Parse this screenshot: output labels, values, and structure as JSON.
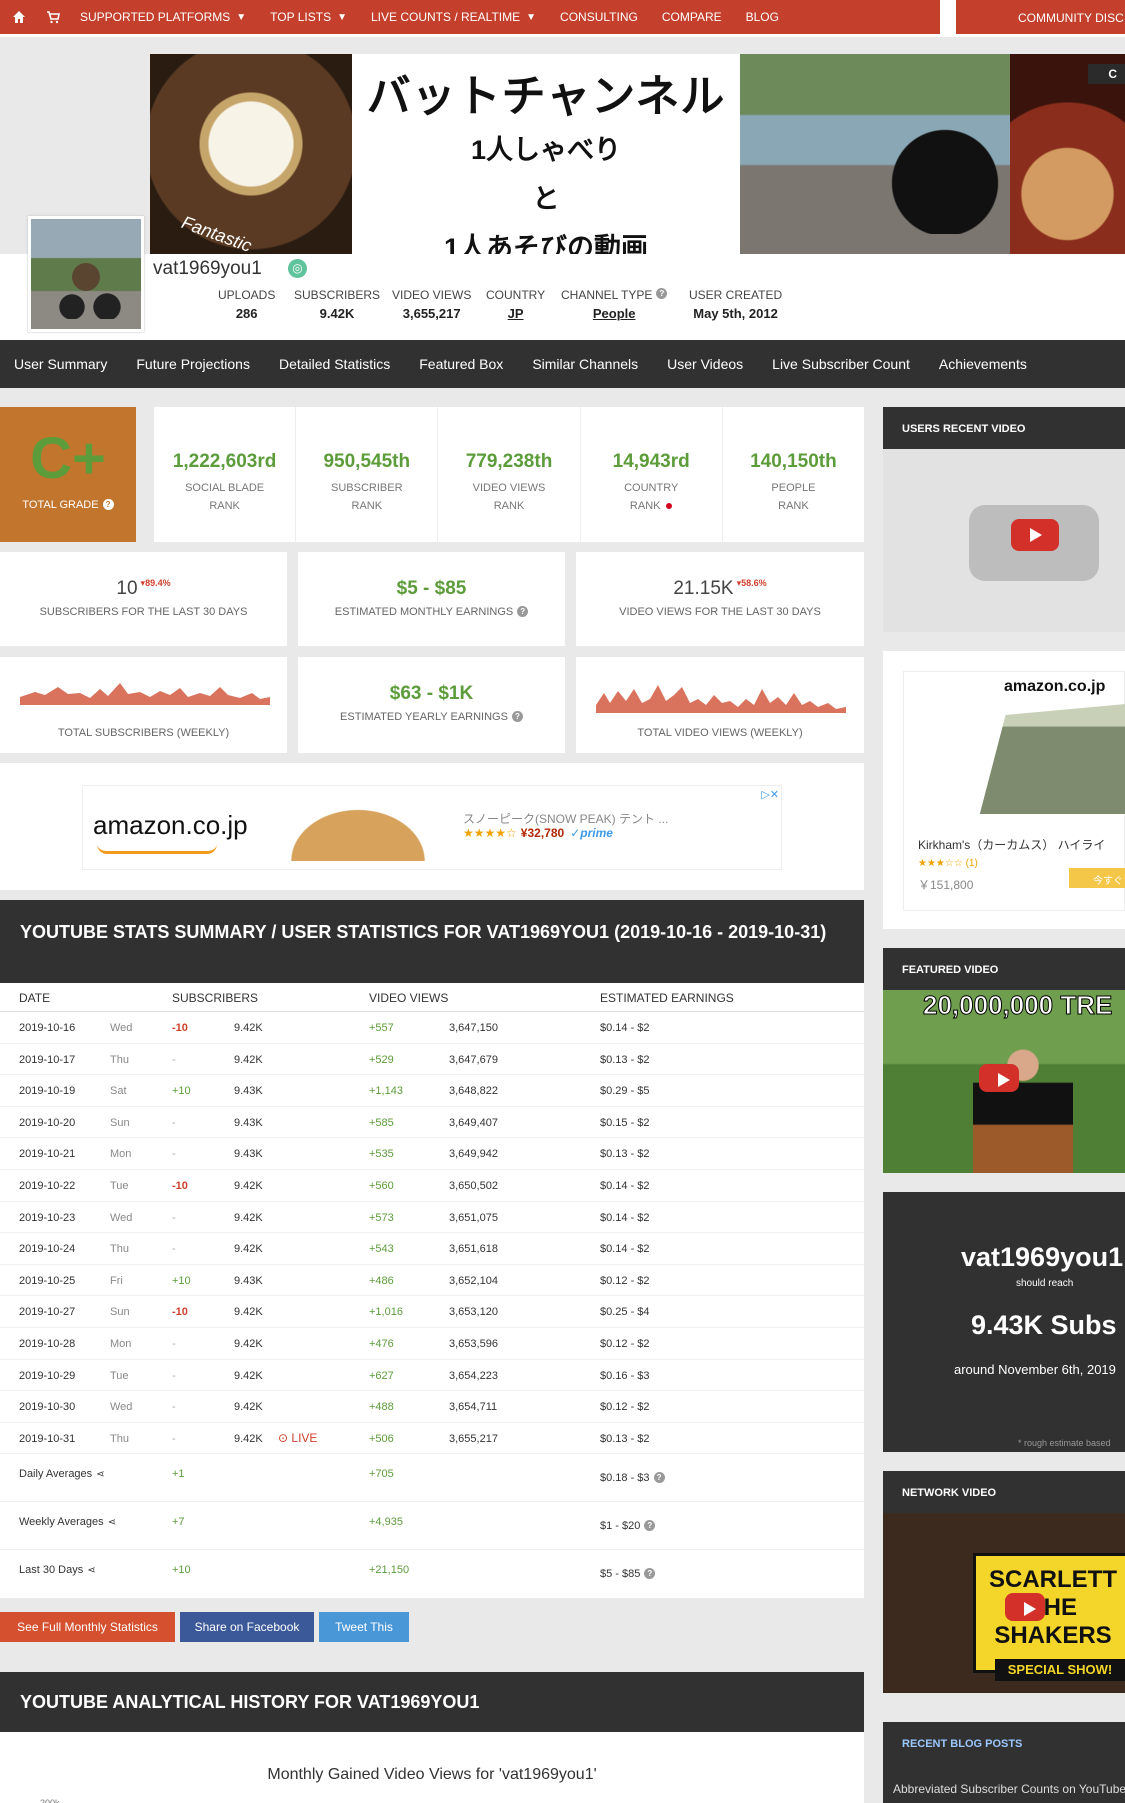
{
  "nav": {
    "items": [
      {
        "label": "SUPPORTED PLATFORMS",
        "caret": "▼"
      },
      {
        "label": "TOP LISTS",
        "caret": "▼"
      },
      {
        "label": "LIVE COUNTS / REALTIME",
        "caret": "▼"
      },
      {
        "label": "CONSULTING",
        "caret": ""
      },
      {
        "label": "COMPARE",
        "caret": ""
      },
      {
        "label": "BLOG",
        "caret": ""
      }
    ],
    "community": "COMMUNITY DISC",
    "accent": "#c4402d"
  },
  "banner": {
    "line1": "バットチャンネル",
    "line2": "1人しゃべり",
    "line3": "と",
    "line4": "1人あそびの動画",
    "fantastic": "Fantastic",
    "tag": "C"
  },
  "profile": {
    "username": "vat1969you1",
    "stats": [
      {
        "label": "UPLOADS",
        "value": "286"
      },
      {
        "label": "SUBSCRIBERS",
        "value": "9.42K"
      },
      {
        "label": "VIDEO VIEWS",
        "value": "3,655,217"
      },
      {
        "label": "COUNTRY",
        "value": "JP"
      },
      {
        "label": "CHANNEL TYPE",
        "value": "People"
      },
      {
        "label": "USER CREATED",
        "value": "May 5th, 2012"
      }
    ]
  },
  "tabs": [
    "User Summary",
    "Future Projections",
    "Detailed Statistics",
    "Featured Box",
    "Similar Channels",
    "User Videos",
    "Live Subscriber Count",
    "Achievements"
  ],
  "grade": {
    "value": "C+",
    "label": "TOTAL GRADE"
  },
  "ranks": [
    {
      "value": "1,222,603rd",
      "l1": "SOCIAL BLADE",
      "l2": "RANK"
    },
    {
      "value": "950,545th",
      "l1": "SUBSCRIBER",
      "l2": "RANK"
    },
    {
      "value": "779,238th",
      "l1": "VIDEO VIEWS",
      "l2": "RANK"
    },
    {
      "value": "14,943rd",
      "l1": "COUNTRY",
      "l2": "RANK"
    },
    {
      "value": "140,150th",
      "l1": "PEOPLE",
      "l2": "RANK"
    }
  ],
  "cards": {
    "subs30": {
      "value": "10",
      "pct": "89.4%",
      "label": "SUBSCRIBERS FOR THE LAST 30 DAYS"
    },
    "monthly": {
      "value": "$5 - $85",
      "label": "ESTIMATED MONTHLY EARNINGS"
    },
    "views30": {
      "value": "21.15K",
      "pct": "58.6%",
      "label": "VIDEO VIEWS FOR THE LAST 30 DAYS"
    },
    "totsubs": {
      "label": "TOTAL SUBSCRIBERS (WEEKLY)"
    },
    "yearly": {
      "value": "$63 - $1K",
      "label": "ESTIMATED YEARLY EARNINGS"
    },
    "totviews": {
      "label": "TOTAL VIDEO VIEWS (WEEKLY)"
    }
  },
  "ad": {
    "logo": "amazon",
    "logo_suffix": ".co.jp",
    "title": "スノーピーク(SNOW PEAK) テント ...",
    "stars": "★★★★☆",
    "price": "¥32,780",
    "prime": "✓prime"
  },
  "summary": {
    "title": "YOUTUBE STATS SUMMARY / USER STATISTICS FOR VAT1969YOU1 (2019-10-16 - 2019-10-31)",
    "headers": [
      "DATE",
      "SUBSCRIBERS",
      "VIDEO VIEWS",
      "ESTIMATED EARNINGS"
    ],
    "rows": [
      {
        "date": "2019-10-16",
        "dow": "Wed",
        "sd": "-10",
        "s": "9.42K",
        "vd": "+557",
        "v": "3,647,150",
        "e": "$0.14  -  $2"
      },
      {
        "date": "2019-10-17",
        "dow": "Thu",
        "sd": "-",
        "s": "9.42K",
        "vd": "+529",
        "v": "3,647,679",
        "e": "$0.13  -  $2"
      },
      {
        "date": "2019-10-19",
        "dow": "Sat",
        "sd": "+10",
        "s": "9.43K",
        "vd": "+1,143",
        "v": "3,648,822",
        "e": "$0.29  -  $5"
      },
      {
        "date": "2019-10-20",
        "dow": "Sun",
        "sd": "-",
        "s": "9.43K",
        "vd": "+585",
        "v": "3,649,407",
        "e": "$0.15  -  $2"
      },
      {
        "date": "2019-10-21",
        "dow": "Mon",
        "sd": "-",
        "s": "9.43K",
        "vd": "+535",
        "v": "3,649,942",
        "e": "$0.13  -  $2"
      },
      {
        "date": "2019-10-22",
        "dow": "Tue",
        "sd": "-10",
        "s": "9.42K",
        "vd": "+560",
        "v": "3,650,502",
        "e": "$0.14  -  $2"
      },
      {
        "date": "2019-10-23",
        "dow": "Wed",
        "sd": "-",
        "s": "9.42K",
        "vd": "+573",
        "v": "3,651,075",
        "e": "$0.14  -  $2"
      },
      {
        "date": "2019-10-24",
        "dow": "Thu",
        "sd": "-",
        "s": "9.42K",
        "vd": "+543",
        "v": "3,651,618",
        "e": "$0.14  -  $2"
      },
      {
        "date": "2019-10-25",
        "dow": "Fri",
        "sd": "+10",
        "s": "9.43K",
        "vd": "+486",
        "v": "3,652,104",
        "e": "$0.12  -  $2"
      },
      {
        "date": "2019-10-27",
        "dow": "Sun",
        "sd": "-10",
        "s": "9.42K",
        "vd": "+1,016",
        "v": "3,653,120",
        "e": "$0.25  -  $4"
      },
      {
        "date": "2019-10-28",
        "dow": "Mon",
        "sd": "-",
        "s": "9.42K",
        "vd": "+476",
        "v": "3,653,596",
        "e": "$0.12  -  $2"
      },
      {
        "date": "2019-10-29",
        "dow": "Tue",
        "sd": "-",
        "s": "9.42K",
        "vd": "+627",
        "v": "3,654,223",
        "e": "$0.16  -  $3"
      },
      {
        "date": "2019-10-30",
        "dow": "Wed",
        "sd": "-",
        "s": "9.42K",
        "vd": "+488",
        "v": "3,654,711",
        "e": "$0.12  -  $2"
      },
      {
        "date": "2019-10-31",
        "dow": "Thu",
        "sd": "-",
        "s": "9.42K",
        "vd": "+506",
        "v": "3,655,217",
        "e": "$0.13  -  $2",
        "live": "LIVE"
      }
    ],
    "averages": [
      {
        "label": "Daily Averages",
        "s": "+1",
        "v": "+705",
        "e": "$0.18  -  $3"
      },
      {
        "label": "Weekly Averages",
        "s": "+7",
        "v": "+4,935",
        "e": "$1  -  $20"
      },
      {
        "label": "Last 30 Days",
        "s": "+10",
        "v": "+21,150",
        "e": "$5  -  $85"
      }
    ]
  },
  "buttons": {
    "monthly": "See Full Monthly Statistics",
    "facebook": "Share on Facebook",
    "tweet": "Tweet This"
  },
  "history": {
    "title": "YOUTUBE ANALYTICAL HISTORY FOR VAT1969YOU1",
    "chart_title": "Monthly Gained Video Views for 'vat1969you1'",
    "y_tick": "200k"
  },
  "sidebar": {
    "recent": "USERS RECENT VIDEO",
    "ad_logo": "amazon.co.jp",
    "ad_name": "Kirkham's（カーカムス） ハイライ",
    "ad_stars": "★★★☆☆ (1)",
    "ad_price": "￥151,800",
    "ad_btn": "今すぐ",
    "featured": "FEATURED VIDEO",
    "featured_title": "20,000,000 TRE",
    "proj_name": "vat1969you1",
    "proj_should": "should reach",
    "proj_subs": "9.43K Subs",
    "proj_around": "around November 6th, 2019",
    "proj_note": "* rough estimate based",
    "network": "NETWORK VIDEO",
    "network_sign": "SCARLETT THE SHAKERS",
    "network_special": "SPECIAL SHOW!",
    "blog": "RECENT BLOG POSTS",
    "blog_item": "Abbreviated Subscriber Counts on YouTube"
  }
}
